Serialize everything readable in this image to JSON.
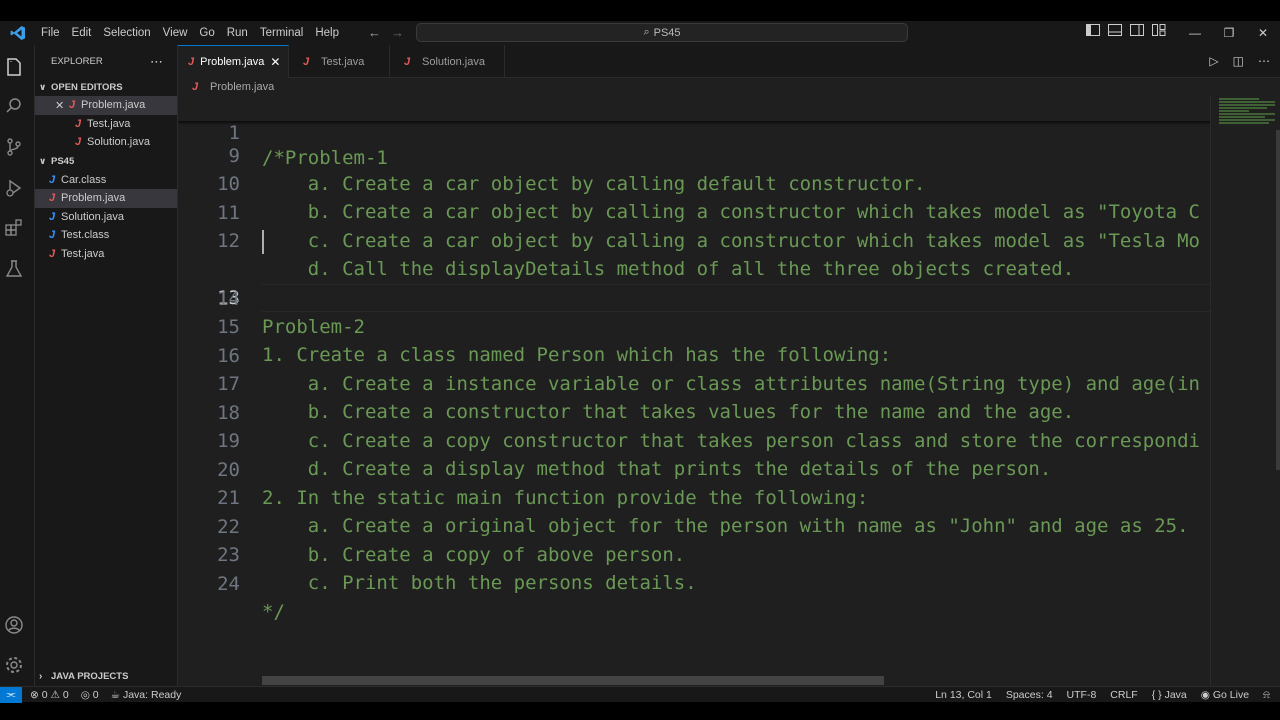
{
  "menu": [
    "File",
    "Edit",
    "Selection",
    "View",
    "Go",
    "Run",
    "Terminal",
    "Help"
  ],
  "command_center": "PS45",
  "explorer": {
    "title": "EXPLORER",
    "open_editors_title": "OPEN EDITORS",
    "open_editors": [
      "Problem.java",
      "Test.java",
      "Solution.java"
    ],
    "folder_title": "PS45",
    "files": [
      {
        "name": "Car.class",
        "type": "class"
      },
      {
        "name": "Problem.java",
        "type": "java"
      },
      {
        "name": "Solution.java",
        "type": "class"
      },
      {
        "name": "Test.class",
        "type": "class"
      },
      {
        "name": "Test.java",
        "type": "java"
      }
    ],
    "java_projects": "JAVA PROJECTS"
  },
  "tabs": [
    {
      "label": "Problem.java",
      "active": true
    },
    {
      "label": "Test.java",
      "active": false
    },
    {
      "label": "Solution.java",
      "active": false
    }
  ],
  "breadcrumb": "Problem.java",
  "editor": {
    "sticky": {
      "num": "1",
      "text": "/*Problem-1"
    },
    "partial": {
      "num": "9",
      "text": "    a. Create a car object by calling default constructor."
    },
    "lines": [
      {
        "num": "10",
        "text": "    b. Create a car object by calling a constructor which takes model as \"Toyota C"
      },
      {
        "num": "11",
        "text": "    c. Create a car object by calling a constructor which takes model as \"Tesla Mo"
      },
      {
        "num": "12",
        "text": "    d. Call the displayDetails method of all the three objects created."
      },
      {
        "num": "13",
        "text": ""
      },
      {
        "num": "14",
        "text": "Problem-2"
      },
      {
        "num": "15",
        "text": "1. Create a class named Person which has the following:"
      },
      {
        "num": "16",
        "text": "    a. Create a instance variable or class attributes name(String type) and age(in"
      },
      {
        "num": "17",
        "text": "    b. Create a constructor that takes values for the name and the age."
      },
      {
        "num": "18",
        "text": "    c. Create a copy constructor that takes person class and store the correspondi"
      },
      {
        "num": "19",
        "text": "    d. Create a display method that prints the details of the person."
      },
      {
        "num": "20",
        "text": "2. In the static main function provide the following:"
      },
      {
        "num": "21",
        "text": "    a. Create a original object for the person with name as \"John\" and age as 25."
      },
      {
        "num": "22",
        "text": "    b. Create a copy of above person."
      },
      {
        "num": "23",
        "text": "    c. Print both the persons details."
      },
      {
        "num": "24",
        "text": "*/"
      }
    ],
    "current_line": "13"
  },
  "status": {
    "errors": "0",
    "warnings": "0",
    "ports": "0",
    "java_status": "Java: Ready",
    "position": "Ln 13, Col 1",
    "spaces": "Spaces: 4",
    "encoding": "UTF-8",
    "eol": "CRLF",
    "language": "Java",
    "go_live": "Go Live"
  },
  "colors": {
    "comment": "#6a9955",
    "accent": "#0078d4",
    "java_icon": "#e05a5a",
    "class_icon": "#3794ff"
  }
}
